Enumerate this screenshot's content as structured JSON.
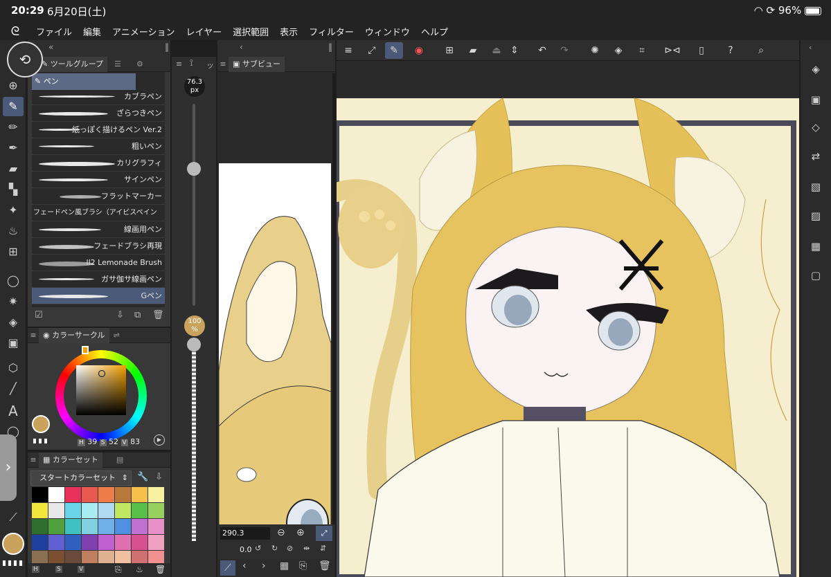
{
  "status": {
    "time": "20:29",
    "date": "6月20日(土)",
    "battery": "96%"
  },
  "menu": [
    "ファイル",
    "編集",
    "アニメーション",
    "レイヤー",
    "選択範囲",
    "表示",
    "フィルター",
    "ウィンドウ",
    "ヘルプ"
  ],
  "toolgroup": {
    "tab_label": "ツールグループ",
    "group_name": "ペン",
    "brushes": [
      "カブラペン",
      "ざらつきペン",
      "紙っぽく描けるペン Ver.2",
      "粗いペン",
      "カリグラフィ",
      "サインペン",
      "フラットマーカー",
      "フェードペン風ブラシ（アイビスペイン",
      "線画用ペン",
      "フェードブラシ再現",
      "ll2 Lemonade Brush",
      "ガサ伽サ線画ペン",
      "Gペン"
    ],
    "active_brush": "Gペン"
  },
  "size": {
    "brush_size": "76.3",
    "unit": "px",
    "opacity": "100",
    "opacity_unit": "%"
  },
  "color_circle": {
    "title": "カラーサークル",
    "h_label": "H",
    "h": "39",
    "s_label": "S",
    "s": "52",
    "v_label": "V",
    "v": "83",
    "current_color": "#c9a35c"
  },
  "color_set": {
    "title": "カラーセット",
    "set_name": "スタートカラーセット",
    "swatches": [
      "#000000",
      "#ffffff",
      "#e8305a",
      "#e85a50",
      "#ef7d4a",
      "#b87a3a",
      "#f5c04a",
      "#f8f2a0",
      "#f0e63c",
      "#e8e8e8",
      "#6ad4e8",
      "#a8ecf0",
      "#b0d8f0",
      "#c0e860",
      "#58c048",
      "#98d060",
      "#2e6e2e",
      "#50a040",
      "#40c0c0",
      "#80d0e0",
      "#70b0e8",
      "#5090e0",
      "#c070d0",
      "#e890c8",
      "#2040a0",
      "#6060d0",
      "#3060c0",
      "#8040b0",
      "#c060d0",
      "#e070b0",
      "#d85090",
      "#f0a0c0",
      "#8a7050",
      "#7a5030",
      "#6a4a3a",
      "#c08060",
      "#e0b090",
      "#f0c0a0",
      "#d07070",
      "#f09090"
    ]
  },
  "subview": {
    "tab_label": "サブビュー",
    "zoom": "290.3",
    "rotation": "0.0"
  },
  "bottom_hsv": {
    "h": "H",
    "s": "S",
    "v": "V"
  }
}
